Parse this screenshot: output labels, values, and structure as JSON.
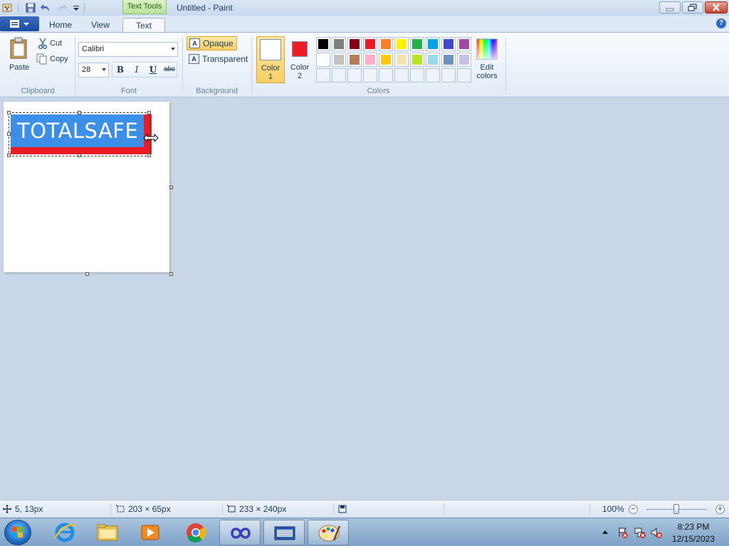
{
  "window": {
    "title": "Untitled - Paint",
    "context_tab_group": "Text Tools"
  },
  "tabs": [
    {
      "label": "Home"
    },
    {
      "label": "View"
    },
    {
      "label": "Text",
      "active": true
    }
  ],
  "ribbon": {
    "clipboard": {
      "paste": "Paste",
      "cut": "Cut",
      "copy": "Copy",
      "group_label": "Clipboard"
    },
    "font": {
      "family": "Calibri",
      "size": "28",
      "bold": "B",
      "italic": "I",
      "underline": "U",
      "strikethrough": "abc",
      "group_label": "Font"
    },
    "background": {
      "opaque": "Opaque",
      "transparent": "Transparent",
      "selected": "Opaque",
      "group_label": "Background"
    },
    "colors": {
      "color1_label": "Color\n1",
      "color1_line1": "Color",
      "color1_line2": "1",
      "color1_value": "#ffffff",
      "color2_line1": "Color",
      "color2_line2": "2",
      "color2_value": "#ed1c24",
      "edit_colors_line1": "Edit",
      "edit_colors_line2": "colors",
      "group_label": "Colors",
      "palette_row1": [
        "#000000",
        "#7f7f7f",
        "#880015",
        "#ed1c24",
        "#ff7f27",
        "#fff200",
        "#22b14c",
        "#00a2e8",
        "#3f48cc",
        "#a349a4"
      ],
      "palette_row2": [
        "#ffffff",
        "#c3c3c3",
        "#b97a57",
        "#ffaec9",
        "#ffc90e",
        "#efe4b0",
        "#b5e61d",
        "#99d9ea",
        "#7092be",
        "#c8bfe7"
      ]
    }
  },
  "canvas": {
    "text": "TOTALSAFE",
    "text_background": "#3c8fe6",
    "shape_color": "#ed1c24"
  },
  "statusbar": {
    "cursor_pos": "5, 13px",
    "selection_size": "203 × 65px",
    "image_size": "233 × 240px",
    "zoom": "100%"
  },
  "taskbar": {
    "time": "8:23 PM",
    "date": "12/15/2023"
  }
}
